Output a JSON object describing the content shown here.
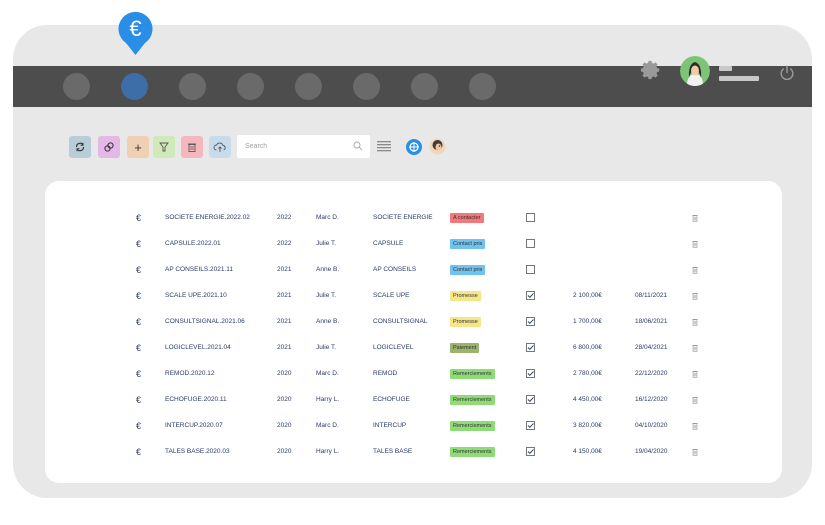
{
  "app": {
    "pin_symbol": "€",
    "nav_items": [
      {
        "name": "nav-item-1",
        "active": false
      },
      {
        "name": "nav-item-2",
        "active": true
      },
      {
        "name": "nav-item-3",
        "active": false
      },
      {
        "name": "nav-item-4",
        "active": false
      },
      {
        "name": "nav-item-5",
        "active": false
      },
      {
        "name": "nav-item-6",
        "active": false
      },
      {
        "name": "nav-item-7",
        "active": false
      },
      {
        "name": "nav-item-8",
        "active": false
      }
    ]
  },
  "header": {
    "icons": [
      "gear-icon",
      "avatar",
      "power-icon"
    ]
  },
  "toolbar": {
    "search_placeholder": "Search",
    "buttons": [
      {
        "icon": "refresh-icon",
        "color": "#b9cdd9"
      },
      {
        "icon": "link-icon",
        "color": "#e3b8e6"
      },
      {
        "icon": "plus-icon",
        "color": "#efd0b3",
        "glyph": "+"
      },
      {
        "icon": "filter-icon",
        "color": "#cfe9b8"
      },
      {
        "icon": "trash-icon",
        "color": "#f3b7bd"
      },
      {
        "icon": "cloud-upload-icon",
        "color": "#c7dcea"
      }
    ]
  },
  "colors": {
    "accent": "#2a8ee6",
    "nav_bg": "#4d4d4d",
    "frame_bg": "#e8e8e8",
    "status_a_contacter": "#f2787c",
    "status_contact_pris": "#6ec3f0",
    "status_promesse": "#f7e58a",
    "status_paiement": "#9bb36a",
    "status_remerciements": "#8edb77"
  },
  "rows": [
    {
      "currency": "€",
      "ref": "SOCIETE ENERGIE.2022.02",
      "year": "2022",
      "user": "Marc D.",
      "client": "SOCIETE ENERGIE",
      "status": "A contacter",
      "status_color": "#f2787c",
      "checked": false,
      "amount": "",
      "date": ""
    },
    {
      "currency": "€",
      "ref": "CAPSULE.2022.01",
      "year": "2022",
      "user": "Julie T.",
      "client": "CAPSULE",
      "status": "Contact pris",
      "status_color": "#6ec3f0",
      "checked": false,
      "amount": "",
      "date": ""
    },
    {
      "currency": "€",
      "ref": "AP CONSEILS.2021.11",
      "year": "2021",
      "user": "Anne B.",
      "client": "AP CONSEILS",
      "status": "Contact pris",
      "status_color": "#6ec3f0",
      "checked": false,
      "amount": "",
      "date": ""
    },
    {
      "currency": "€",
      "ref": "SCALE UPE.2021.10",
      "year": "2021",
      "user": "Julie T.",
      "client": "SCALE UPE",
      "status": "Promesse",
      "status_color": "#f7e58a",
      "checked": true,
      "amount": "2 100,00€",
      "date": "08/11/2021"
    },
    {
      "currency": "€",
      "ref": "CONSULTSIGNAL.2021.06",
      "year": "2021",
      "user": "Anne B.",
      "client": "CONSULTSIGNAL",
      "status": "Promesse",
      "status_color": "#f7e58a",
      "checked": true,
      "amount": "1 700,00€",
      "date": "18/06/2021"
    },
    {
      "currency": "€",
      "ref": "LOGICLEVEL.2021.04",
      "year": "2021",
      "user": "Julie T.",
      "client": "LOGICLEVEL",
      "status": "Paiement",
      "status_color": "#9bb36a",
      "checked": true,
      "amount": "6 800,00€",
      "date": "28/04/2021"
    },
    {
      "currency": "€",
      "ref": "REMOD.2020.12",
      "year": "2020",
      "user": "Marc D.",
      "client": "REMOD",
      "status": "Remerciements",
      "status_color": "#8edb77",
      "checked": true,
      "amount": "2 780,00€",
      "date": "22/12/2020"
    },
    {
      "currency": "€",
      "ref": "ECHOFUGE.2020.11",
      "year": "2020",
      "user": "Harry L.",
      "client": "ECHOFUGE",
      "status": "Remerciements",
      "status_color": "#8edb77",
      "checked": true,
      "amount": "4 450,00€",
      "date": "16/12/2020"
    },
    {
      "currency": "€",
      "ref": "INTERCUP.2020.07",
      "year": "2020",
      "user": "Marc D.",
      "client": "INTERCUP",
      "status": "Remerciements",
      "status_color": "#8edb77",
      "checked": true,
      "amount": "3 820,00€",
      "date": "04/10/2020"
    },
    {
      "currency": "€",
      "ref": "TALES BASE.2020.03",
      "year": "2020",
      "user": "Harry L.",
      "client": "TALES BASE",
      "status": "Remerciements",
      "status_color": "#8edb77",
      "checked": true,
      "amount": "4 150,00€",
      "date": "19/04/2020"
    }
  ]
}
